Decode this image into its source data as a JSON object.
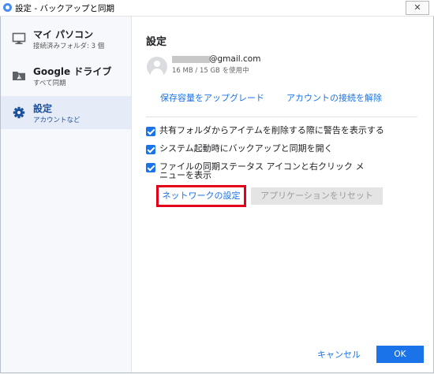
{
  "window": {
    "title": "設定 - バックアップと同期",
    "close_glyph": "✕"
  },
  "sidebar": {
    "items": [
      {
        "label": "マイ パソコン",
        "sublabel": "接続済みフォルダ: 3 個",
        "icon": "monitor-icon"
      },
      {
        "label": "Google ドライブ",
        "sublabel": "すべて同期",
        "icon": "drive-folder-icon"
      },
      {
        "label": "設定",
        "sublabel": "アカウントなど",
        "icon": "gear-icon",
        "selected": true
      }
    ]
  },
  "settings": {
    "title": "設定",
    "account": {
      "email_suffix": "@gmail.com",
      "storage": "16 MB / 15 GB を使用中"
    },
    "upgrade_link": "保存容量をアップグレード",
    "disconnect_link": "アカウントの接続を解除",
    "checkboxes": [
      {
        "label": "共有フォルダからアイテムを削除する際に警告を表示する",
        "checked": true
      },
      {
        "label": "システム起動時にバックアップと同期を開く",
        "checked": true
      },
      {
        "label": "ファイルの同期ステータス アイコンと右クリック メニューを表示",
        "checked": true
      }
    ],
    "network_button": "ネットワークの設定",
    "reset_button": "アプリケーションをリセット"
  },
  "footer": {
    "cancel": "キャンセル",
    "ok": "OK"
  },
  "colors": {
    "accent": "#1a73e8",
    "highlight_border": "#e4001b",
    "sidebar_selected": "#e6ecf7"
  }
}
